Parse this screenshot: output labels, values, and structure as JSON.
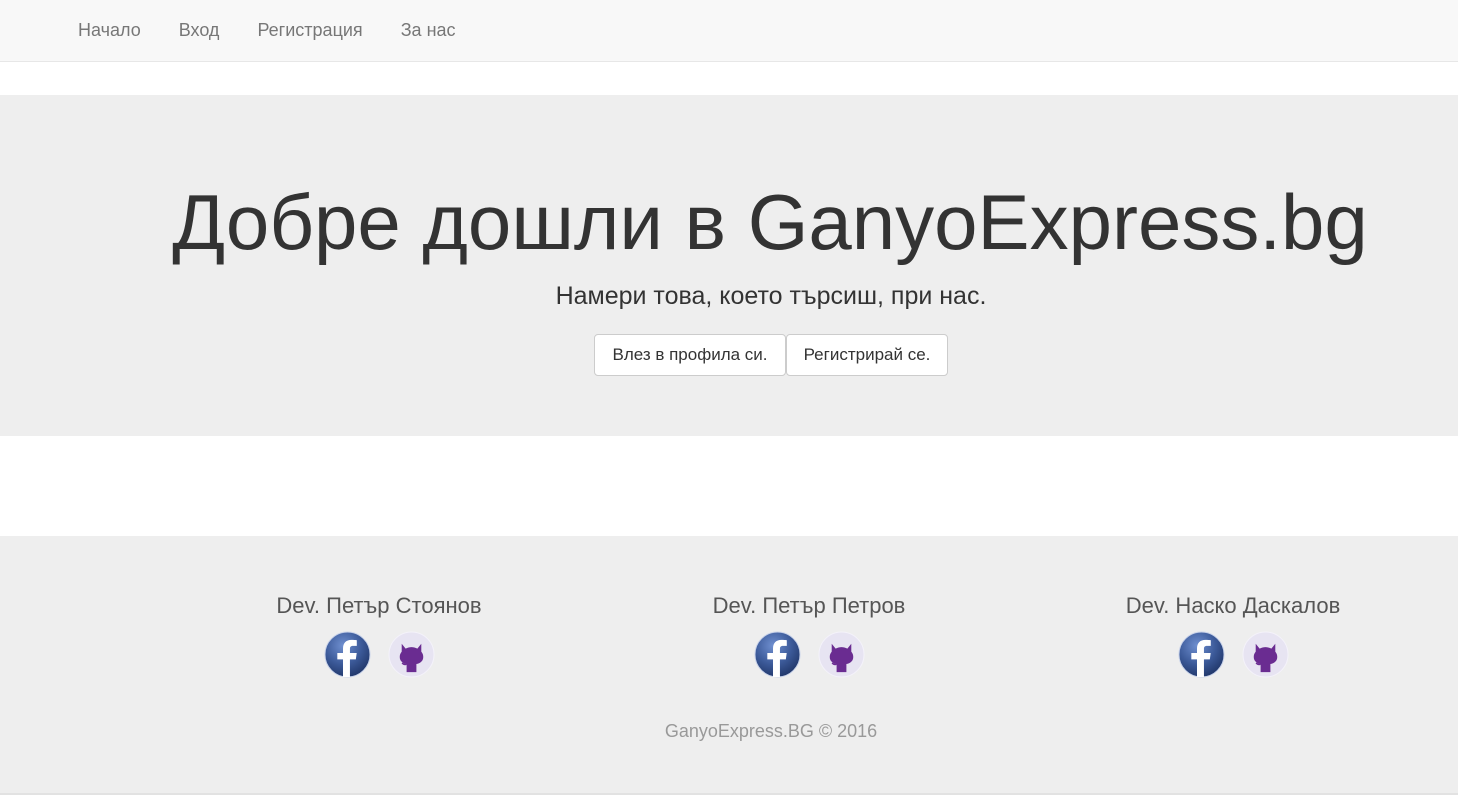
{
  "nav": {
    "items": [
      {
        "label": "Начало"
      },
      {
        "label": "Вход"
      },
      {
        "label": "Регистрация"
      },
      {
        "label": "За нас"
      }
    ]
  },
  "hero": {
    "title": "Добре дошли в GanyoExpress.bg",
    "subtitle": "Намери това, което търсиш, при нас.",
    "login_button": "Влез в профила си.",
    "register_button": "Регистрирай се."
  },
  "footer": {
    "developers": [
      {
        "name": "Dev. Петър Стоянов",
        "icons": [
          "facebook-icon",
          "github-icon"
        ]
      },
      {
        "name": "Dev. Петър Петров",
        "icons": [
          "facebook-icon",
          "github-icon"
        ]
      },
      {
        "name": "Dev. Наско Даскалов",
        "icons": [
          "facebook-icon",
          "github-icon"
        ]
      }
    ],
    "copyright": "GanyoExpress.BG © 2016"
  },
  "colors": {
    "facebook_blue": "#3b5998",
    "github_purple": "#6a2c91",
    "jumbotron_bg": "#eeeeee",
    "navbar_bg": "#f8f8f8"
  }
}
